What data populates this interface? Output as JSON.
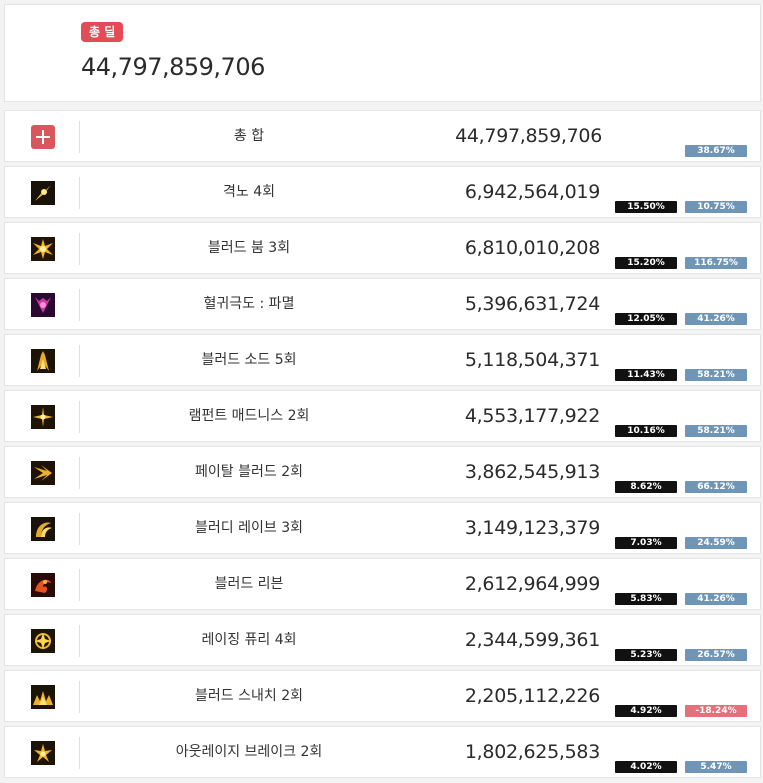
{
  "summary": {
    "badge_label": "총 딜",
    "total": "44,797,859,706"
  },
  "rows": [
    {
      "icon": "plus-icon",
      "name": "총 합",
      "damage": "44,797,859,706",
      "share": "",
      "ratio": "38.67%",
      "ratio_negative": false
    },
    {
      "icon": "skill-gyeokno-icon",
      "name": "격노 4회",
      "damage": "6,942,564,019",
      "share": "15.50%",
      "ratio": "10.75%",
      "ratio_negative": false
    },
    {
      "icon": "skill-blood-boom-icon",
      "name": "블러드 붐 3회",
      "damage": "6,810,010,208",
      "share": "15.20%",
      "ratio": "116.75%",
      "ratio_negative": false
    },
    {
      "icon": "skill-hyeolgwi-icon",
      "name": "혈귀극도 : 파멸",
      "damage": "5,396,631,724",
      "share": "12.05%",
      "ratio": "41.26%",
      "ratio_negative": false
    },
    {
      "icon": "skill-blood-sword-icon",
      "name": "블러드 소드 5회",
      "damage": "5,118,504,371",
      "share": "11.43%",
      "ratio": "58.21%",
      "ratio_negative": false
    },
    {
      "icon": "skill-rampant-icon",
      "name": "램펀트 매드니스 2회",
      "damage": "4,553,177,922",
      "share": "10.16%",
      "ratio": "58.21%",
      "ratio_negative": false
    },
    {
      "icon": "skill-fatal-blood-icon",
      "name": "페이탈 블러드 2회",
      "damage": "3,862,545,913",
      "share": "8.62%",
      "ratio": "66.12%",
      "ratio_negative": false
    },
    {
      "icon": "skill-bloody-rave-icon",
      "name": "블러디 레이브 3회",
      "damage": "3,149,123,379",
      "share": "7.03%",
      "ratio": "24.59%",
      "ratio_negative": false
    },
    {
      "icon": "skill-blood-reborn-icon",
      "name": "블러드 리븐",
      "damage": "2,612,964,999",
      "share": "5.83%",
      "ratio": "41.26%",
      "ratio_negative": false
    },
    {
      "icon": "skill-raging-fury-icon",
      "name": "레이징 퓨리 4회",
      "damage": "2,344,599,361",
      "share": "5.23%",
      "ratio": "26.57%",
      "ratio_negative": false
    },
    {
      "icon": "skill-blood-snatch-icon",
      "name": "블러드 스내치 2회",
      "damage": "2,205,112,226",
      "share": "4.92%",
      "ratio": "-18.24%",
      "ratio_negative": true
    },
    {
      "icon": "skill-outrage-break-icon",
      "name": "아웃레이지 브레이크 2회",
      "damage": "1,802,625,583",
      "share": "4.02%",
      "ratio": "5.47%",
      "ratio_negative": false
    }
  ],
  "colors": {
    "badge": "#e34b56",
    "share_pill": "#111111",
    "ratio_pill": "#6f96b7",
    "ratio_pill_negative": "#e3707a",
    "plus_icon_bg": "#d9575c"
  }
}
